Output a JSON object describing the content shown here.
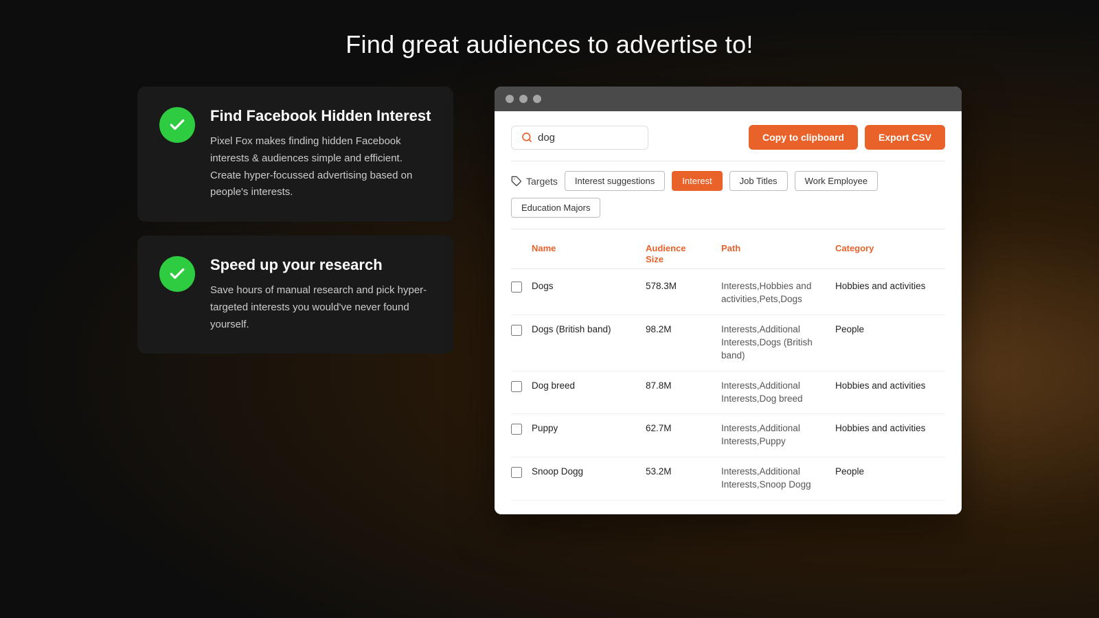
{
  "page": {
    "title": "Find great audiences to advertise to!",
    "background_colors": [
      "#0d0d0d",
      "#5a3a1a"
    ]
  },
  "features": [
    {
      "id": "find-interest",
      "heading": "Find Facebook Hidden Interest",
      "body": "Pixel Fox makes finding hidden Facebook interests & audiences simple and efficient. Create hyper-focussed advertising based on people's interests."
    },
    {
      "id": "speed-research",
      "heading": "Speed up your research",
      "body": "Save hours of manual research and pick hyper-targeted interests you would've never found yourself."
    }
  ],
  "browser": {
    "dots": [
      "dot1",
      "dot2",
      "dot3"
    ]
  },
  "app": {
    "search": {
      "value": "dog",
      "placeholder": "Search"
    },
    "buttons": {
      "copy": "Copy to clipboard",
      "export": "Export CSV"
    },
    "targets_label": "Targets",
    "filters": [
      {
        "label": "Interest suggestions",
        "active": false
      },
      {
        "label": "Interest",
        "active": true
      },
      {
        "label": "Job Titles",
        "active": false
      },
      {
        "label": "Work Employee",
        "active": false
      },
      {
        "label": "Education Majors",
        "active": false
      }
    ],
    "table": {
      "headers": [
        {
          "key": "checkbox",
          "label": ""
        },
        {
          "key": "name",
          "label": "Name"
        },
        {
          "key": "audience_size",
          "label": "Audience Size"
        },
        {
          "key": "path",
          "label": "Path"
        },
        {
          "key": "category",
          "label": "Category"
        }
      ],
      "rows": [
        {
          "name": "Dogs",
          "audience_size": "578.3M",
          "path": "Interests,Hobbies and activities,Pets,Dogs",
          "category": "Hobbies and activities"
        },
        {
          "name": "Dogs (British band)",
          "audience_size": "98.2M",
          "path": "Interests,Additional Interests,Dogs (British band)",
          "category": "People"
        },
        {
          "name": "Dog breed",
          "audience_size": "87.8M",
          "path": "Interests,Additional Interests,Dog breed",
          "category": "Hobbies and activities"
        },
        {
          "name": "Puppy",
          "audience_size": "62.7M",
          "path": "Interests,Additional Interests,Puppy",
          "category": "Hobbies and activities"
        },
        {
          "name": "Snoop Dogg",
          "audience_size": "53.2M",
          "path": "Interests,Additional Interests,Snoop Dogg",
          "category": "People"
        }
      ]
    }
  }
}
